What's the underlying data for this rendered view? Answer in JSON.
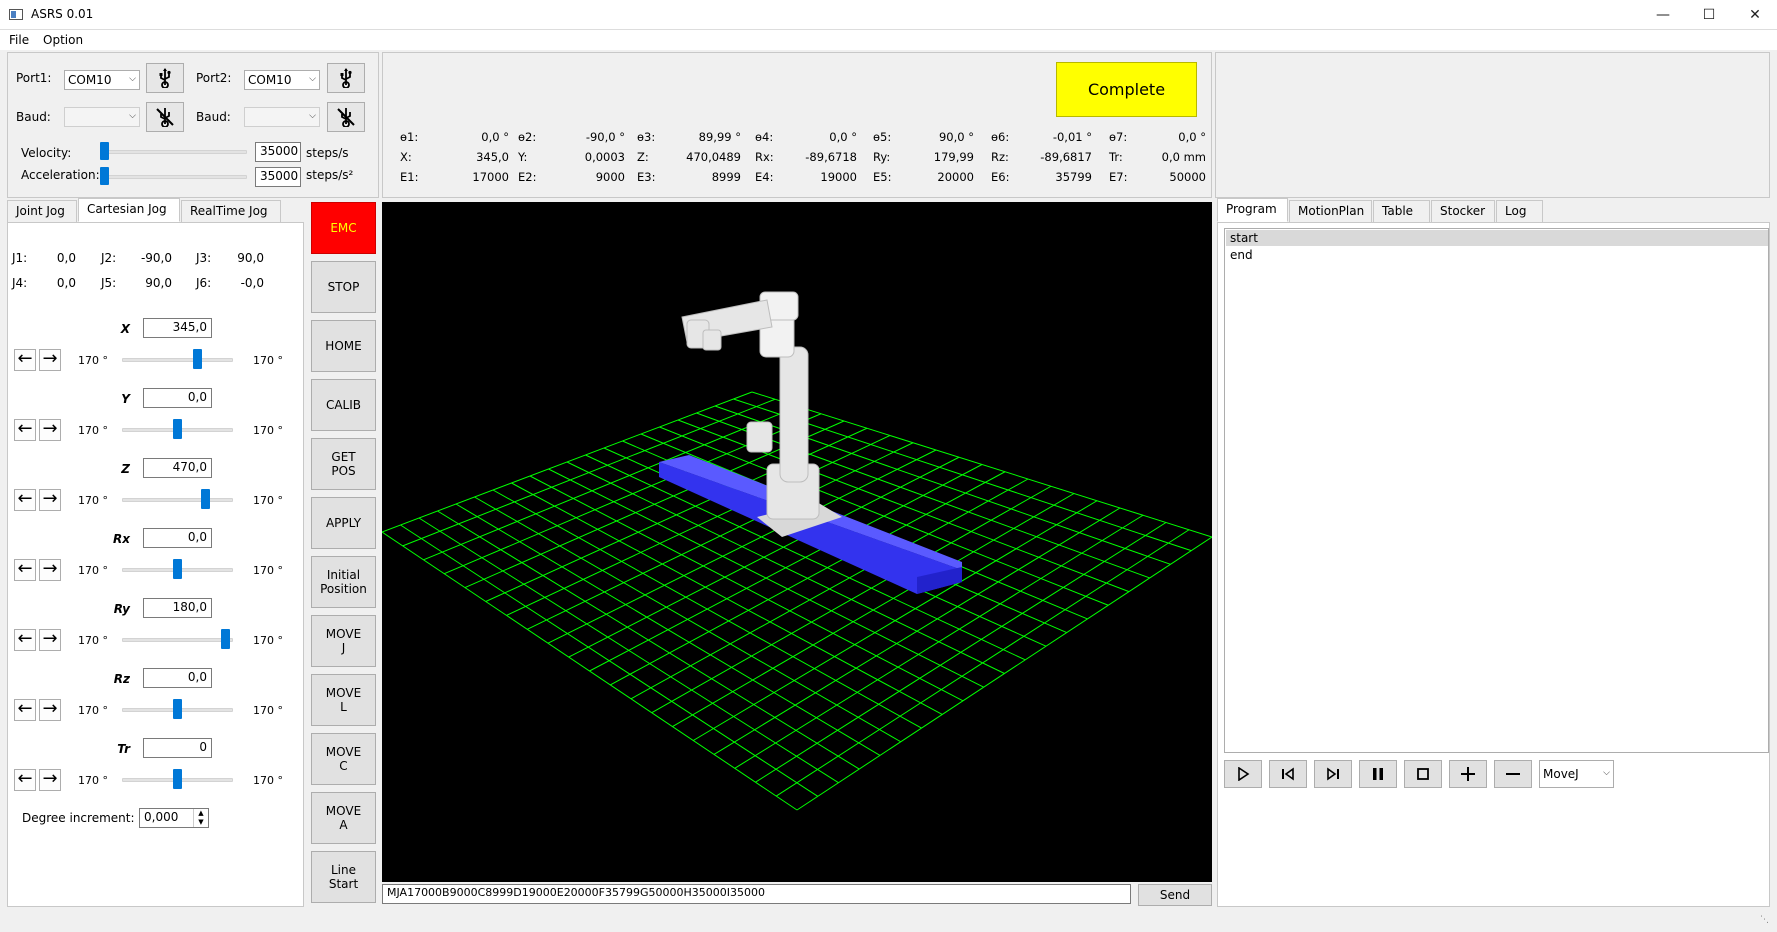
{
  "window": {
    "title": "ASRS 0.01"
  },
  "menu": [
    "File",
    "Option"
  ],
  "connection": {
    "port1_label": "Port1:",
    "port1_value": "COM10",
    "port2_label": "Port2:",
    "port2_value": "COM10",
    "baud1_label": "Baud:",
    "baud2_label": "Baud:",
    "velocity_label": "Velocity:",
    "velocity_value": "35000",
    "velocity_unit": "steps/s",
    "acceleration_label": "Acceleration:",
    "acceleration_value": "35000",
    "acceleration_unit": "steps/s²",
    "velocity_level": 0.0,
    "acceleration_level": 0.0
  },
  "status": {
    "complete_label": "Complete",
    "complete_color": "#ffff00",
    "rows": [
      [
        [
          "ɵ1:",
          "0,0 °"
        ],
        [
          "ɵ2:",
          "-90,0 °"
        ],
        [
          "ɵ3:",
          "89,99 °"
        ],
        [
          "ɵ4:",
          "0,0 °"
        ],
        [
          "ɵ5:",
          "90,0 °"
        ],
        [
          "ɵ6:",
          "-0,01 °"
        ],
        [
          "ɵ7:",
          "0,0 °"
        ]
      ],
      [
        [
          "X:",
          "345,0"
        ],
        [
          "Y:",
          "0,0003"
        ],
        [
          "Z:",
          "470,0489"
        ],
        [
          "Rx:",
          "-89,6718"
        ],
        [
          "Ry:",
          "179,99"
        ],
        [
          "Rz:",
          "-89,6817"
        ],
        [
          "Tr:",
          "0,0 mm"
        ]
      ],
      [
        [
          "E1:",
          "17000"
        ],
        [
          "E2:",
          "9000"
        ],
        [
          "E3:",
          "8999"
        ],
        [
          "E4:",
          "19000"
        ],
        [
          "E5:",
          "20000"
        ],
        [
          "E6:",
          "35799"
        ],
        [
          "E7:",
          "50000"
        ]
      ]
    ]
  },
  "jog_tabs": [
    "Joint Jog",
    "Cartesian Jog",
    "RealTime Jog"
  ],
  "joints": [
    [
      "J1:",
      "0,0"
    ],
    [
      "J2:",
      "-90,0"
    ],
    [
      "J3:",
      "90,0"
    ],
    [
      "J4:",
      "0,0"
    ],
    [
      "J5:",
      "90,0"
    ],
    [
      "J6:",
      "-0,0"
    ]
  ],
  "axes": [
    {
      "name": "X",
      "value": "345,0",
      "min": "170 °",
      "max": "170 °",
      "level": 0.7
    },
    {
      "name": "Y",
      "value": "0,0",
      "min": "170 °",
      "max": "170 °",
      "level": 0.5
    },
    {
      "name": "Z",
      "value": "470,0",
      "min": "170 °",
      "max": "170 °",
      "level": 0.77
    },
    {
      "name": "Rx",
      "value": "0,0",
      "min": "170 °",
      "max": "170 °",
      "level": 0.5
    },
    {
      "name": "Ry",
      "value": "180,0",
      "min": "170 °",
      "max": "170 °",
      "level": 0.97
    },
    {
      "name": "Rz",
      "value": "0,0",
      "min": "170 °",
      "max": "170 °",
      "level": 0.5
    },
    {
      "name": "Tr",
      "value": "0",
      "min": "170 °",
      "max": "170 °",
      "level": 0.5
    }
  ],
  "degree_increment": {
    "label": "Degree increment:",
    "value": "0,000"
  },
  "side_buttons": [
    {
      "label": "EMC",
      "color": "#ff0000",
      "text_color": "#ffff00"
    },
    {
      "label": "STOP"
    },
    {
      "label": "HOME"
    },
    {
      "label": "CALIB"
    },
    {
      "label": "GET\nPOS"
    },
    {
      "label": "APPLY"
    },
    {
      "label": "Initial\nPosition"
    },
    {
      "label": "MOVE\nJ"
    },
    {
      "label": "MOVE\nL"
    },
    {
      "label": "MOVE\nC"
    },
    {
      "label": "MOVE\nA"
    },
    {
      "label": "Line\nStart"
    }
  ],
  "viewport": {
    "background": "#000000",
    "grid_color": "#00ff00",
    "rail_color": "#3333ee"
  },
  "command": {
    "value": "MJA17000B9000C8999D19000E20000F35799G50000H35000I35000",
    "send_label": "Send"
  },
  "program_tabs": [
    "Program",
    "MotionPlan",
    "Table",
    "Stocker",
    "Log"
  ],
  "program_lines": [
    "start",
    "end"
  ],
  "program_controls": {
    "move_type": "MoveJ"
  }
}
